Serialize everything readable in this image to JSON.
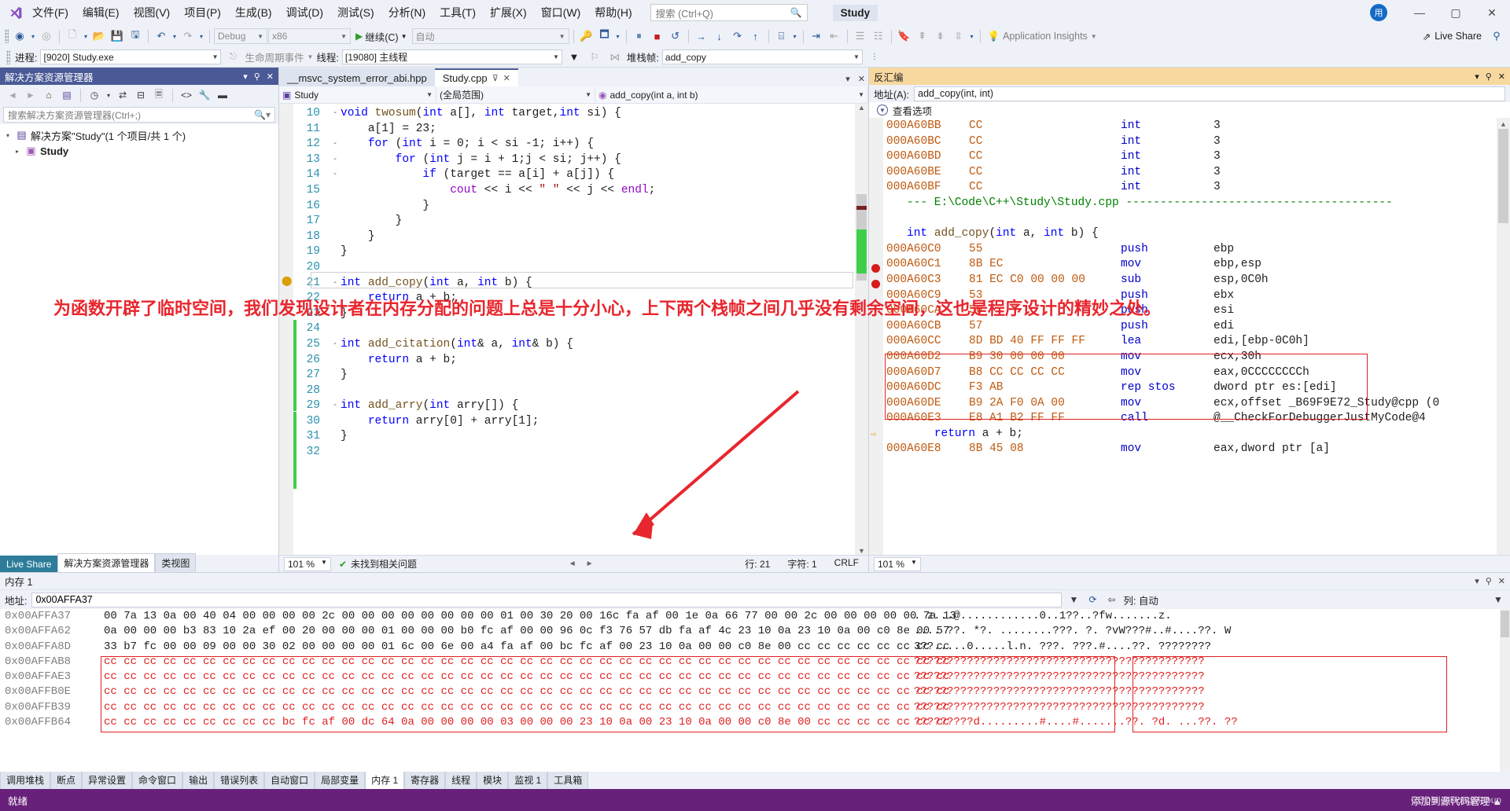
{
  "menubar": {
    "logo": "vs-logo",
    "items": [
      "文件(F)",
      "编辑(E)",
      "视图(V)",
      "项目(P)",
      "生成(B)",
      "调试(D)",
      "测试(S)",
      "分析(N)",
      "工具(T)",
      "扩展(X)",
      "窗口(W)",
      "帮助(H)"
    ],
    "search_placeholder": "搜索 (Ctrl+Q)",
    "title": "Study",
    "avatar": "用",
    "minimize": "—",
    "maximize": "▢",
    "close": "✕"
  },
  "toolbar": {
    "config": "Debug",
    "platform": "x86",
    "continue_label": "继续(C)",
    "auto_label": "自动",
    "app_insights": "Application Insights",
    "live_share": "Live Share"
  },
  "debugbar": {
    "process_label": "进程:",
    "process_value": "[9020] Study.exe",
    "lifecycle_label": "生命周期事件",
    "thread_label": "线程:",
    "thread_value": "[19080] 主线程",
    "stackframe_label": "堆栈帧:",
    "stackframe_value": "add_copy"
  },
  "solution_explorer": {
    "title": "解决方案资源管理器",
    "search_placeholder": "搜索解决方案资源管理器(Ctrl+;)",
    "root": "解决方案\"Study\"(1 个项目/共 1 个)",
    "project": "Study",
    "footer_tabs": [
      "Live Share",
      "解决方案资源管理器",
      "类视图"
    ]
  },
  "editor": {
    "tabs": [
      {
        "label": "__msvc_system_error_abi.hpp",
        "active": false
      },
      {
        "label": "Study.cpp",
        "active": true
      }
    ],
    "nav": {
      "project": "Study",
      "scope": "(全局范围)",
      "member": "add_copy(int a, int b)"
    },
    "code": [
      {
        "n": 10,
        "fold": "-",
        "text": "void twosum(int a[], int target,int si) {",
        "indent": 0
      },
      {
        "n": 11,
        "fold": "",
        "text": "a[1] = 23;",
        "indent": 1
      },
      {
        "n": 12,
        "fold": "-",
        "text": "for (int i = 0; i < si -1; i++) {",
        "indent": 1
      },
      {
        "n": 13,
        "fold": "-",
        "text": "for (int j = i + 1;j < si; j++) {",
        "indent": 2
      },
      {
        "n": 14,
        "fold": "-",
        "text": "if (target == a[i] + a[j]) {",
        "indent": 3
      },
      {
        "n": 15,
        "fold": "",
        "text": "cout << i << \" \" << j << endl;",
        "indent": 4
      },
      {
        "n": 16,
        "fold": "",
        "text": "}",
        "indent": 3
      },
      {
        "n": 17,
        "fold": "",
        "text": "}",
        "indent": 2
      },
      {
        "n": 18,
        "fold": "",
        "text": "}",
        "indent": 1
      },
      {
        "n": 19,
        "fold": "",
        "text": "}",
        "indent": 0
      },
      {
        "n": 20,
        "fold": "",
        "text": "",
        "indent": 0
      },
      {
        "n": 21,
        "fold": "-",
        "text": "int add_copy(int a, int b) {",
        "indent": 0
      },
      {
        "n": 22,
        "fold": "",
        "text": "return a + b;",
        "indent": 1
      },
      {
        "n": 23,
        "fold": "",
        "text": "}",
        "indent": 0
      },
      {
        "n": 24,
        "fold": "",
        "text": "",
        "indent": 0
      },
      {
        "n": 25,
        "fold": "-",
        "text": "int add_citation(int& a, int& b) {",
        "indent": 0
      },
      {
        "n": 26,
        "fold": "",
        "text": "return a + b;",
        "indent": 1
      },
      {
        "n": 27,
        "fold": "",
        "text": "}",
        "indent": 0
      },
      {
        "n": 28,
        "fold": "",
        "text": "",
        "indent": 0
      },
      {
        "n": 29,
        "fold": "-",
        "text": "int add_arry(int arry[]) {",
        "indent": 0
      },
      {
        "n": 30,
        "fold": "",
        "text": "return arry[0] + arry[1];",
        "indent": 1
      },
      {
        "n": 31,
        "fold": "",
        "text": "}",
        "indent": 0
      },
      {
        "n": 32,
        "fold": "",
        "text": "",
        "indent": 0
      }
    ],
    "status": {
      "zoom": "101 %",
      "issues": "未找到相关问题",
      "line": "行: 21",
      "col": "字符: 1",
      "eol": "CRLF"
    }
  },
  "disassembly": {
    "title": "反汇编",
    "address_label": "地址(A):",
    "address_value": "add_copy(int, int)",
    "view_options": "查看选项",
    "status_zoom": "101 %",
    "rows": [
      {
        "type": "asm",
        "addr": "000A60BB",
        "bytes": "CC",
        "mnem": "int",
        "ops": "3",
        "bp": false
      },
      {
        "type": "asm",
        "addr": "000A60BC",
        "bytes": "CC",
        "mnem": "int",
        "ops": "3",
        "bp": false
      },
      {
        "type": "asm",
        "addr": "000A60BD",
        "bytes": "CC",
        "mnem": "int",
        "ops": "3",
        "bp": false
      },
      {
        "type": "asm",
        "addr": "000A60BE",
        "bytes": "CC",
        "mnem": "int",
        "ops": "3",
        "bp": false
      },
      {
        "type": "asm",
        "addr": "000A60BF",
        "bytes": "CC",
        "mnem": "int",
        "ops": "3",
        "bp": false
      },
      {
        "type": "file",
        "text": "--- E:\\Code\\C++\\Study\\Study.cpp ---------------------------------------"
      },
      {
        "type": "blank",
        "text": ""
      },
      {
        "type": "src",
        "text": "int add_copy(int a, int b) {"
      },
      {
        "type": "asm",
        "addr": "000A60C0",
        "bytes": "55",
        "mnem": "push",
        "ops": "ebp",
        "bp": true
      },
      {
        "type": "asm",
        "addr": "000A60C1",
        "bytes": "8B EC",
        "mnem": "mov",
        "ops": "ebp,esp",
        "bp": true
      },
      {
        "type": "asm",
        "addr": "000A60C3",
        "bytes": "81 EC C0 00 00 00",
        "mnem": "sub",
        "ops": "esp,0C0h",
        "bp": false
      },
      {
        "type": "asm",
        "addr": "000A60C9",
        "bytes": "53",
        "mnem": "push",
        "ops": "ebx",
        "bp": false
      },
      {
        "type": "asm",
        "addr": "000A60CA",
        "bytes": "56",
        "mnem": "push",
        "ops": "esi",
        "bp": false
      },
      {
        "type": "asm",
        "addr": "000A60CB",
        "bytes": "57",
        "mnem": "push",
        "ops": "edi",
        "bp": false
      },
      {
        "type": "asm",
        "addr": "000A60CC",
        "bytes": "8D BD 40 FF FF FF",
        "mnem": "lea",
        "ops": "edi,[ebp-0C0h]",
        "bp": false
      },
      {
        "type": "asm",
        "addr": "000A60D2",
        "bytes": "B9 30 00 00 00",
        "mnem": "mov",
        "ops": "ecx,30h",
        "bp": false
      },
      {
        "type": "asm",
        "addr": "000A60D7",
        "bytes": "B8 CC CC CC CC",
        "mnem": "mov",
        "ops": "eax,0CCCCCCCCh",
        "bp": false
      },
      {
        "type": "asm",
        "addr": "000A60DC",
        "bytes": "F3 AB",
        "mnem": "rep stos",
        "ops": "dword ptr es:[edi]",
        "bp": false
      },
      {
        "type": "asm",
        "addr": "000A60DE",
        "bytes": "B9 2A F0 0A 00",
        "mnem": "mov",
        "ops": "ecx,offset _B69F9E72_Study@cpp (0",
        "bp": false
      },
      {
        "type": "asm",
        "addr": "000A60E3",
        "bytes": "E8 A1 B2 FF FF",
        "mnem": "call",
        "ops": "@__CheckForDebuggerJustMyCode@4",
        "bp": false
      },
      {
        "type": "src",
        "text": "    return a + b;"
      },
      {
        "type": "asm",
        "addr": "000A60E8",
        "bytes": "8B 45 08",
        "mnem": "mov",
        "ops": "eax,dword ptr [a]",
        "bp": false
      }
    ]
  },
  "memory": {
    "title": "内存 1",
    "address_label": "地址:",
    "address_value": "0x00AFFA37",
    "columns_label": "列: 自动",
    "rows": [
      {
        "addr": "0x00AFFA37",
        "hex": "00 7a 13 0a 00 40 04 00 00 00 00 2c 00 00 00 00 00 00 00 00 01 00 30 20 00 16c fa af 00 1e 0a 66 77 00 00 2c 00 00 00 00 00 7a 13",
        "ascii": ". z...@............0..1??..?fw.......z.",
        "cc": false
      },
      {
        "addr": "0x00AFFA62",
        "hex": "0a 00 00 00 b3 83 10 2a ef 00 20 00 00 00 01 00 00 00 b0 fc af 00 00 96 0c f3 76 57 db fa af 4c 23 10 0a 23 10 0a 00 c0 8e 00 57",
        "ascii": ".... ??. *?. ........???. ?. ?vW???#..#....??. W",
        "cc": false
      },
      {
        "addr": "0x00AFFA8D",
        "hex": "33 b7 fc 00 00 09 00 00 30 02 00 00 00 00 01 6c 00 6e 00 a4 fa af 00 bc fc af 00 23 10 0a 00 00 c0 8e 00 cc cc cc cc cc cc cc cc",
        "ascii": "3??.....0.....l.n. ???. ???.#....??. ????????",
        "cc": false
      },
      {
        "addr": "0x00AFFAB8",
        "hex": "cc cc cc cc cc cc cc cc cc cc cc cc cc cc cc cc cc cc cc cc cc cc cc cc cc cc cc cc cc cc cc cc cc cc cc cc cc cc cc cc cc cc cc",
        "ascii": "????????????????????????????????????????????",
        "cc": true
      },
      {
        "addr": "0x00AFFAE3",
        "hex": "cc cc cc cc cc cc cc cc cc cc cc cc cc cc cc cc cc cc cc cc cc cc cc cc cc cc cc cc cc cc cc cc cc cc cc cc cc cc cc cc cc cc cc",
        "ascii": "????????????????????????????????????????????",
        "cc": true
      },
      {
        "addr": "0x00AFFB0E",
        "hex": "cc cc cc cc cc cc cc cc cc cc cc cc cc cc cc cc cc cc cc cc cc cc cc cc cc cc cc cc cc cc cc cc cc cc cc cc cc cc cc cc cc cc cc",
        "ascii": "????????????????????????????????????????????",
        "cc": true
      },
      {
        "addr": "0x00AFFB39",
        "hex": "cc cc cc cc cc cc cc cc cc cc cc cc cc cc cc cc cc cc cc cc cc cc cc cc cc cc cc cc cc cc cc cc cc cc cc cc cc cc cc cc cc cc cc",
        "ascii": "????????????????????????????????????????????",
        "cc": true
      },
      {
        "addr": "0x00AFFB64",
        "hex": "cc cc cc cc cc cc cc cc cc bc fc af 00 dc 64 0a 00 00 00 00 03 00 00 00 23 10 0a 00 23 10 0a 00 00 c0 8e 00 cc cc cc cc cc cc cc",
        "ascii": "?????????d.........#....#.......??. ?d. ...??. ??",
        "cc": true
      }
    ],
    "tabs": [
      "调用堆栈",
      "断点",
      "异常设置",
      "命令窗口",
      "输出",
      "错误列表",
      "自动窗口",
      "局部变量",
      "内存 1",
      "寄存器",
      "线程",
      "模块",
      "监视 1",
      "工具箱"
    ],
    "active_tab": "内存 1"
  },
  "statusbar": {
    "ready": "就绪",
    "watermark": "添加到源代码管理 ▲",
    "credit": "CSDN @DongMaoup"
  },
  "annotations": {
    "line1": "为函数开辟了临时空间，我们发现设计者在内存分配的问题上总是十分小心，上下两个栈帧之间几乎没有剩余空间，这也是程序设计的精妙之处。",
    "arrow": "red-arrow"
  },
  "colors": {
    "accent": "#4a5a96",
    "disassembly_header": "#f7d9a0",
    "annotation_red": "#e8262d",
    "status_purple": "#68217a",
    "keyword_blue": "#0000ff",
    "type_teal": "#2b91af",
    "string_red": "#a31515",
    "comment_green": "#008000",
    "addr_orange": "#c05a10"
  }
}
